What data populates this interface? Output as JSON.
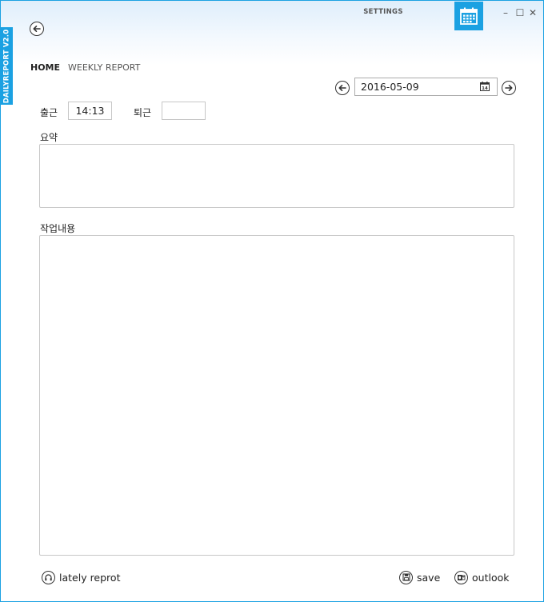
{
  "window": {
    "app_name": "DAILYREPORT V2.0",
    "settings_label": "SETTINGS",
    "controls": {
      "minimize": "–",
      "maximize": "☐",
      "close": "✕"
    }
  },
  "nav": {
    "home": "HOME",
    "weekly_report": "WEEKLY REPORT"
  },
  "date_picker": {
    "value": "2016-05-09",
    "calendar_day": "14"
  },
  "attendance": {
    "clock_in_label": "출근",
    "clock_in_value": "14:13",
    "clock_out_label": "퇴근",
    "clock_out_value": ""
  },
  "summary": {
    "label": "요약",
    "value": ""
  },
  "work_content": {
    "label": "작업내용",
    "value": ""
  },
  "footer": {
    "lately_label": "lately reprot",
    "save_label": "save",
    "outlook_label": "outlook"
  },
  "colors": {
    "accent": "#1ba1e2",
    "border": "#c7c7c7"
  },
  "icons": [
    "back-arrow-icon",
    "calendar-icon",
    "left-arrow-icon",
    "right-arrow-icon",
    "headset-icon",
    "save-icon",
    "outlook-icon"
  ]
}
